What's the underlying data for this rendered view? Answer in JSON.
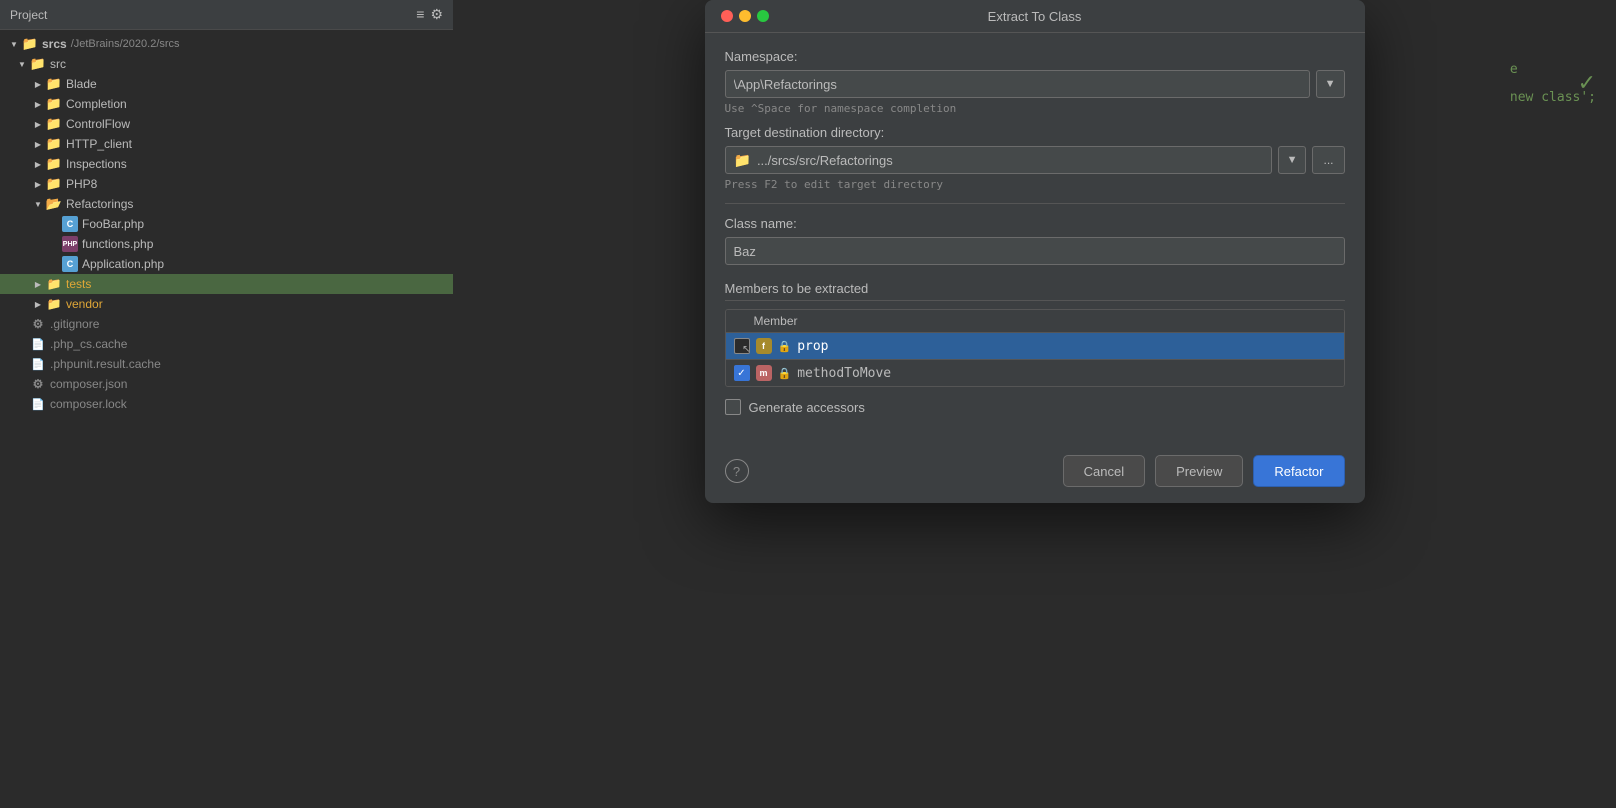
{
  "window": {
    "title": "Extract To Class"
  },
  "trafficLights": {
    "red": "close",
    "yellow": "minimize",
    "green": "maximize"
  },
  "leftPanel": {
    "title": "Project",
    "rootLabel": "srcs",
    "rootPath": "/JetBrains/2020.2/srcs",
    "treeItems": [
      {
        "id": "srcs-root",
        "level": 0,
        "expanded": true,
        "type": "folder-open",
        "label": "srcs",
        "sublabel": "/JetBrains/2020.2/srcs",
        "color": "blue"
      },
      {
        "id": "src",
        "level": 1,
        "expanded": true,
        "type": "folder-open",
        "label": "src",
        "color": "blue"
      },
      {
        "id": "blade",
        "level": 2,
        "expanded": false,
        "type": "folder",
        "label": "Blade",
        "color": "blue"
      },
      {
        "id": "completion",
        "level": 2,
        "expanded": false,
        "type": "folder",
        "label": "Completion",
        "color": "blue"
      },
      {
        "id": "controlflow",
        "level": 2,
        "expanded": false,
        "type": "folder",
        "label": "ControlFlow",
        "color": "blue"
      },
      {
        "id": "http-client",
        "level": 2,
        "expanded": false,
        "type": "folder",
        "label": "HTTP_client",
        "color": "blue"
      },
      {
        "id": "inspections",
        "level": 2,
        "expanded": false,
        "type": "folder",
        "label": "Inspections",
        "color": "blue"
      },
      {
        "id": "php8",
        "level": 2,
        "expanded": false,
        "type": "folder",
        "label": "PHP8",
        "color": "blue"
      },
      {
        "id": "refactorings",
        "level": 2,
        "expanded": true,
        "type": "folder-open",
        "label": "Refactorings",
        "color": "blue"
      },
      {
        "id": "foobar",
        "level": 3,
        "type": "file-c",
        "label": "FooBar.php",
        "color": "normal"
      },
      {
        "id": "functions",
        "level": 3,
        "type": "file-php",
        "label": "functions.php",
        "color": "normal"
      },
      {
        "id": "application",
        "level": 3,
        "type": "file-c",
        "label": "Application.php",
        "color": "normal"
      },
      {
        "id": "tests",
        "level": 2,
        "expanded": false,
        "type": "folder",
        "label": "tests",
        "color": "yellow",
        "selected": true
      },
      {
        "id": "vendor",
        "level": 2,
        "expanded": false,
        "type": "folder",
        "label": "vendor",
        "color": "yellow"
      },
      {
        "id": "gitignore",
        "level": 1,
        "type": "file-gear",
        "label": ".gitignore",
        "color": "gray"
      },
      {
        "id": "php-cs-cache",
        "level": 1,
        "type": "file-doc",
        "label": ".php_cs.cache",
        "color": "gray"
      },
      {
        "id": "phpunit-cache",
        "level": 1,
        "type": "file-doc",
        "label": ".phpunit.result.cache",
        "color": "gray"
      },
      {
        "id": "composer-json",
        "level": 1,
        "type": "file-composer",
        "label": "composer.json",
        "color": "gray"
      },
      {
        "id": "composer-lock",
        "level": 1,
        "type": "file-doc",
        "label": "composer.lock",
        "color": "gray"
      }
    ]
  },
  "dialog": {
    "title": "Extract To Class",
    "namespace": {
      "label": "Namespace:",
      "value": "\\App\\Refactorings",
      "hint": "Use ^Space for namespace completion"
    },
    "targetDir": {
      "label": "Target destination directory:",
      "value": ".../srcs/src/Refactorings",
      "hint": "Press F2 to edit target directory",
      "browseLabel": "..."
    },
    "className": {
      "label": "Class name:",
      "value": "Baz"
    },
    "membersSection": {
      "label": "Members to be extracted",
      "columnHeader": "Member",
      "rows": [
        {
          "id": "prop",
          "checked": false,
          "badgeType": "f",
          "hasLock": true,
          "name": "prop",
          "selected": true
        },
        {
          "id": "methodToMove",
          "checked": true,
          "badgeType": "m",
          "hasLock": true,
          "name": "methodToMove",
          "selected": false
        }
      ]
    },
    "generateAccessors": {
      "label": "Generate accessors",
      "checked": false
    },
    "buttons": {
      "help": "?",
      "cancel": "Cancel",
      "preview": "Preview",
      "refactor": "Refactor"
    }
  },
  "codeArea": {
    "line1": "e",
    "line2": "new class';"
  },
  "checkmark": "✓"
}
